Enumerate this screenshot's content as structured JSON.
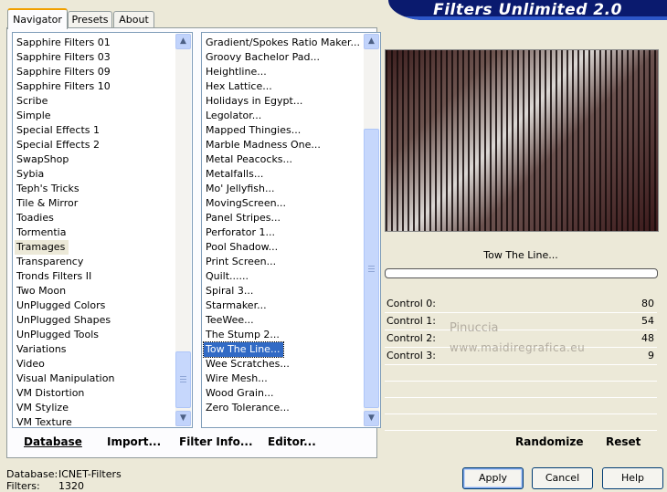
{
  "banner": {
    "title": "Filters Unlimited 2.0"
  },
  "tabs": [
    {
      "label": "Navigator",
      "active": true
    },
    {
      "label": "Presets",
      "active": false
    },
    {
      "label": "About",
      "active": false
    }
  ],
  "categories": {
    "items": [
      "Sapphire Filters 01",
      "Sapphire Filters 03",
      "Sapphire Filters 09",
      "Sapphire Filters 10",
      "Scribe",
      "Simple",
      "Special Effects 1",
      "Special Effects 2",
      "SwapShop",
      "Sybia",
      "Teph's Tricks",
      "Tile & Mirror",
      "Toadies",
      "Tormentia",
      "Tramages",
      "Transparency",
      "Tronds Filters II",
      "Two Moon",
      "UnPlugged Colors",
      "UnPlugged Shapes",
      "UnPlugged Tools",
      "Variations",
      "Video",
      "Visual Manipulation",
      "VM Distortion",
      "VM Stylize",
      "VM Texture"
    ],
    "highlighted": "Tramages"
  },
  "filters": {
    "items": [
      "Gradient/Spokes Ratio Maker...",
      "Groovy Bachelor Pad...",
      "Heightline...",
      "Hex Lattice...",
      "Holidays in Egypt...",
      "Legolator...",
      "Mapped Thingies...",
      "Marble Madness One...",
      "Metal Peacocks...",
      "Metalfalls...",
      "Mo' Jellyfish...",
      "MovingScreen...",
      "Panel Stripes...",
      "Perforator 1...",
      "Pool Shadow...",
      "Print Screen...",
      "Quilt......",
      "Spiral 3...",
      "Starmaker...",
      "TeeWee...",
      "The Stump 2...",
      "Tow The Line...",
      "Wee Scratches...",
      "Wire Mesh...",
      "Wood Grain...",
      "Zero Tolerance..."
    ],
    "selected": "Tow The Line..."
  },
  "preview": {
    "filter_name": "Tow The Line..."
  },
  "controls": [
    {
      "label": "Control 0:",
      "value": "80"
    },
    {
      "label": "Control 1:",
      "value": "54"
    },
    {
      "label": "Control 2:",
      "value": "48"
    },
    {
      "label": "Control 3:",
      "value": "9"
    }
  ],
  "watermark": {
    "line1": "Pinuccia",
    "line2": "www.maidiregrafica.eu"
  },
  "left_bar": {
    "database": "Database",
    "import": "Import...",
    "filter_info": "Filter Info...",
    "editor": "Editor..."
  },
  "right_bar": {
    "randomize": "Randomize",
    "reset": "Reset"
  },
  "status": {
    "database_label": "Database:",
    "database_value": "ICNET-Filters",
    "filters_label": "Filters:",
    "filters_value": "1320"
  },
  "buttons": {
    "apply": "Apply",
    "cancel": "Cancel",
    "help": "Help"
  },
  "icons": {
    "scroll_up": "▲",
    "scroll_down": "▼"
  }
}
